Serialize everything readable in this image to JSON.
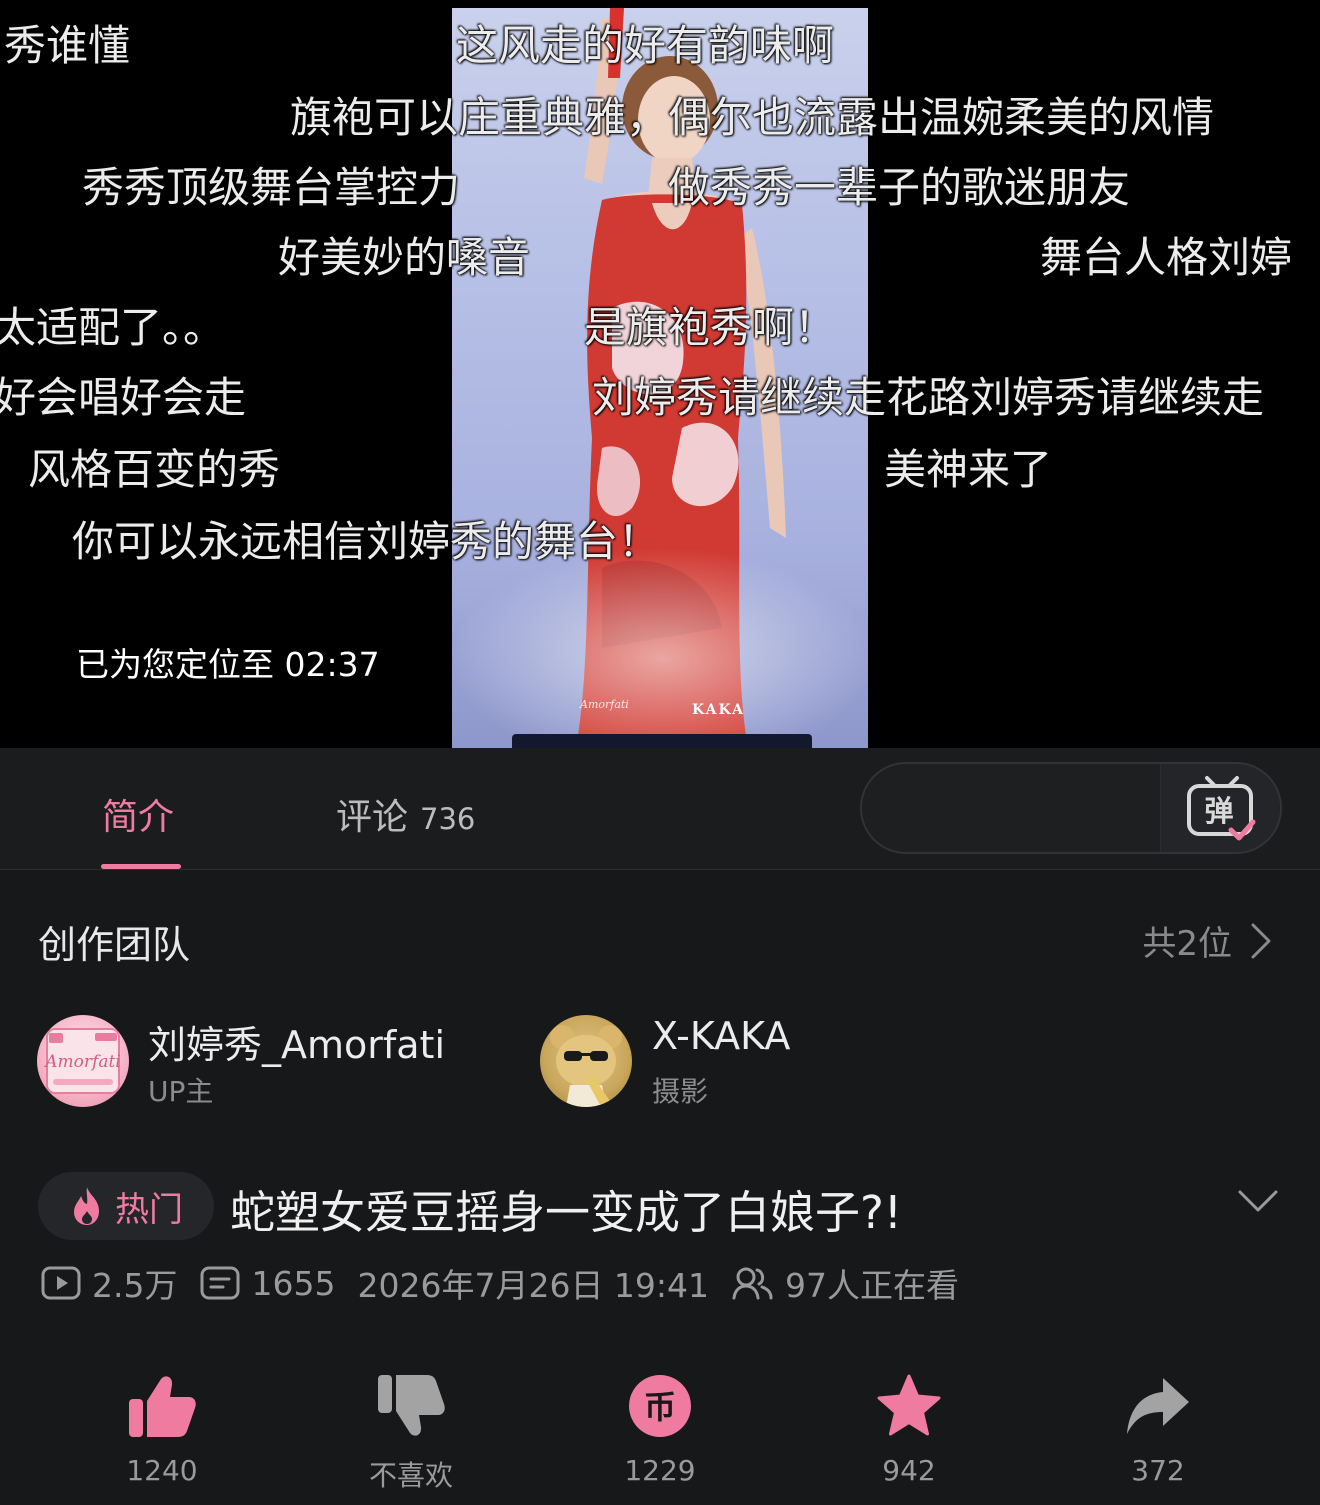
{
  "player": {
    "danmaku": [
      "秀谁懂",
      "这风走的好有韵味啊",
      "旗袍可以庄重典雅，偶尔也流露出温婉柔美的风情",
      "秀秀顶级舞台掌控力",
      "做秀秀一辈子的歌迷朋友",
      "好美妙的嗓音",
      "舞台人格刘婷",
      "太适配了。。",
      "是旗袍秀啊！",
      "好会唱好会走",
      "刘婷秀请继续走花路刘婷秀请继续走",
      "风格百变的秀",
      "美神来了",
      "你可以永远相信刘婷秀的舞台！"
    ],
    "locate_toast": "已为您定位至 02:37",
    "watermark_signature": "Amorfati",
    "watermark_brand": "KAKA"
  },
  "tabs": {
    "intro_label": "简介",
    "comments_label": "评论",
    "comments_count": "736"
  },
  "danmaku_input": {
    "placeholder": "",
    "toggle_glyph": "弹"
  },
  "creators": {
    "title": "创作团队",
    "count_label": "共2位",
    "members": [
      {
        "name": "刘婷秀_Amorfati",
        "role": "UP主",
        "avatar_text": "Amorfati"
      },
      {
        "name": "X-KAKA",
        "role": "摄影"
      }
    ]
  },
  "video": {
    "hot_label": "热门",
    "title": "蛇塑女爱豆摇身一变成了白娘子?!"
  },
  "stats": {
    "views": "2.5万",
    "danmaku_count": "1655",
    "publish_time": "2026年7月26日 19:41",
    "watching": "97人正在看"
  },
  "actions": {
    "like": "1240",
    "dislike": "不喜欢",
    "coin": "1229",
    "coin_glyph": "币",
    "favorite": "942",
    "share": "372"
  },
  "colors": {
    "accent_pink": "#f07ba0",
    "background": "#17181a",
    "muted_text": "#9a9a9a"
  }
}
